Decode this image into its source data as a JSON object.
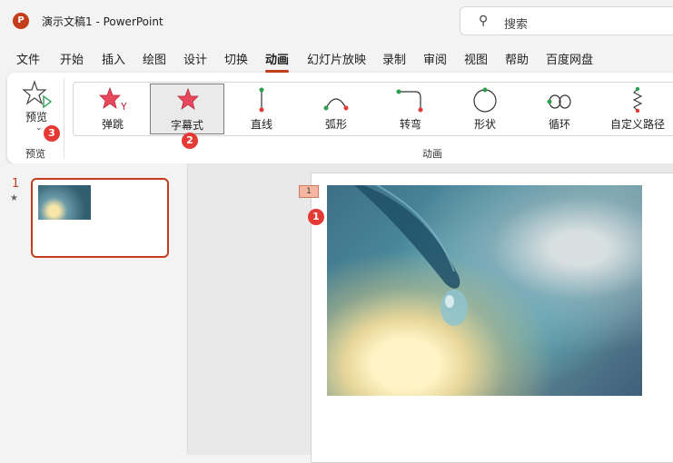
{
  "app": {
    "logo_letter": "P",
    "title": "演示文稿1  -  PowerPoint",
    "search_placeholder": "搜索"
  },
  "menu": [
    {
      "label": "文件"
    },
    {
      "label": "开始"
    },
    {
      "label": "插入"
    },
    {
      "label": "绘图"
    },
    {
      "label": "设计"
    },
    {
      "label": "切换"
    },
    {
      "label": "动画",
      "active": true
    },
    {
      "label": "幻灯片放映"
    },
    {
      "label": "录制"
    },
    {
      "label": "审阅"
    },
    {
      "label": "视图"
    },
    {
      "label": "帮助"
    },
    {
      "label": "百度网盘"
    }
  ],
  "ribbon": {
    "preview": {
      "button_label": "预览",
      "group_label": "预览",
      "badge": "3"
    },
    "animations": {
      "group_label": "动画",
      "items": [
        {
          "label": "弹跳",
          "icon": "bounce-star-icon"
        },
        {
          "label": "字幕式",
          "icon": "credits-star-icon",
          "selected": true,
          "badge": "2"
        },
        {
          "label": "直线",
          "icon": "line-path-icon"
        },
        {
          "label": "弧形",
          "icon": "arc-path-icon"
        },
        {
          "label": "转弯",
          "icon": "turn-path-icon"
        },
        {
          "label": "形状",
          "icon": "shape-path-icon"
        },
        {
          "label": "循环",
          "icon": "loop-path-icon"
        },
        {
          "label": "自定义路径",
          "icon": "custom-path-icon"
        }
      ]
    }
  },
  "slides_pane": {
    "slide_number": "1",
    "star": "★"
  },
  "canvas": {
    "animation_tag": "1",
    "badge": "1"
  },
  "colors": {
    "accent": "#c43e1c",
    "badge": "#e53935"
  }
}
